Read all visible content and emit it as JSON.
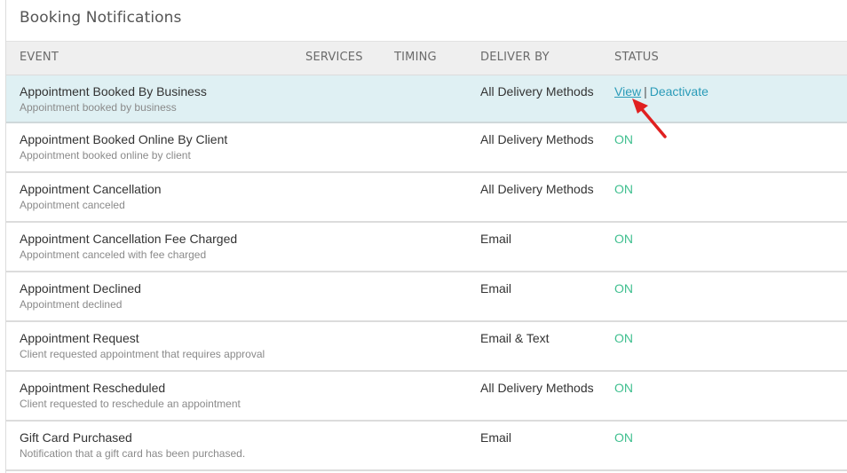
{
  "panel": {
    "title": "Booking Notifications"
  },
  "columns": {
    "event": "EVENT",
    "services": "SERVICES",
    "timing": "TIMING",
    "deliver_by": "DELIVER BY",
    "status": "STATUS"
  },
  "rows": [
    {
      "title": "Appointment Booked By Business",
      "subtitle": "Appointment booked by business",
      "deliver_by": "All Delivery Methods",
      "status": "",
      "view_label": "View",
      "separator": "|",
      "deactivate_label": "Deactivate"
    },
    {
      "title": "Appointment Booked Online By Client",
      "subtitle": "Appointment booked online by client",
      "deliver_by": "All Delivery Methods",
      "status": "ON"
    },
    {
      "title": "Appointment Cancellation",
      "subtitle": "Appointment canceled",
      "deliver_by": "All Delivery Methods",
      "status": "ON"
    },
    {
      "title": "Appointment Cancellation Fee Charged",
      "subtitle": "Appointment canceled with fee charged",
      "deliver_by": "Email",
      "status": "ON"
    },
    {
      "title": "Appointment Declined",
      "subtitle": "Appointment declined",
      "deliver_by": "Email",
      "status": "ON"
    },
    {
      "title": "Appointment Request",
      "subtitle": "Client requested appointment that requires approval",
      "deliver_by": "Email & Text",
      "status": "ON"
    },
    {
      "title": "Appointment Rescheduled",
      "subtitle": "Client requested to reschedule an appointment",
      "deliver_by": "All Delivery Methods",
      "status": "ON"
    },
    {
      "title": "Gift Card Purchased",
      "subtitle": "Notification that a gift card has been purchased.",
      "deliver_by": "Email",
      "status": "ON"
    }
  ],
  "colors": {
    "status_on": "#3fbf8f",
    "link": "#2a9bb8",
    "selected_row": "#dff0f3",
    "annotation_arrow": "#e02020"
  },
  "icons": {
    "annotation": "red-arrow-icon"
  }
}
